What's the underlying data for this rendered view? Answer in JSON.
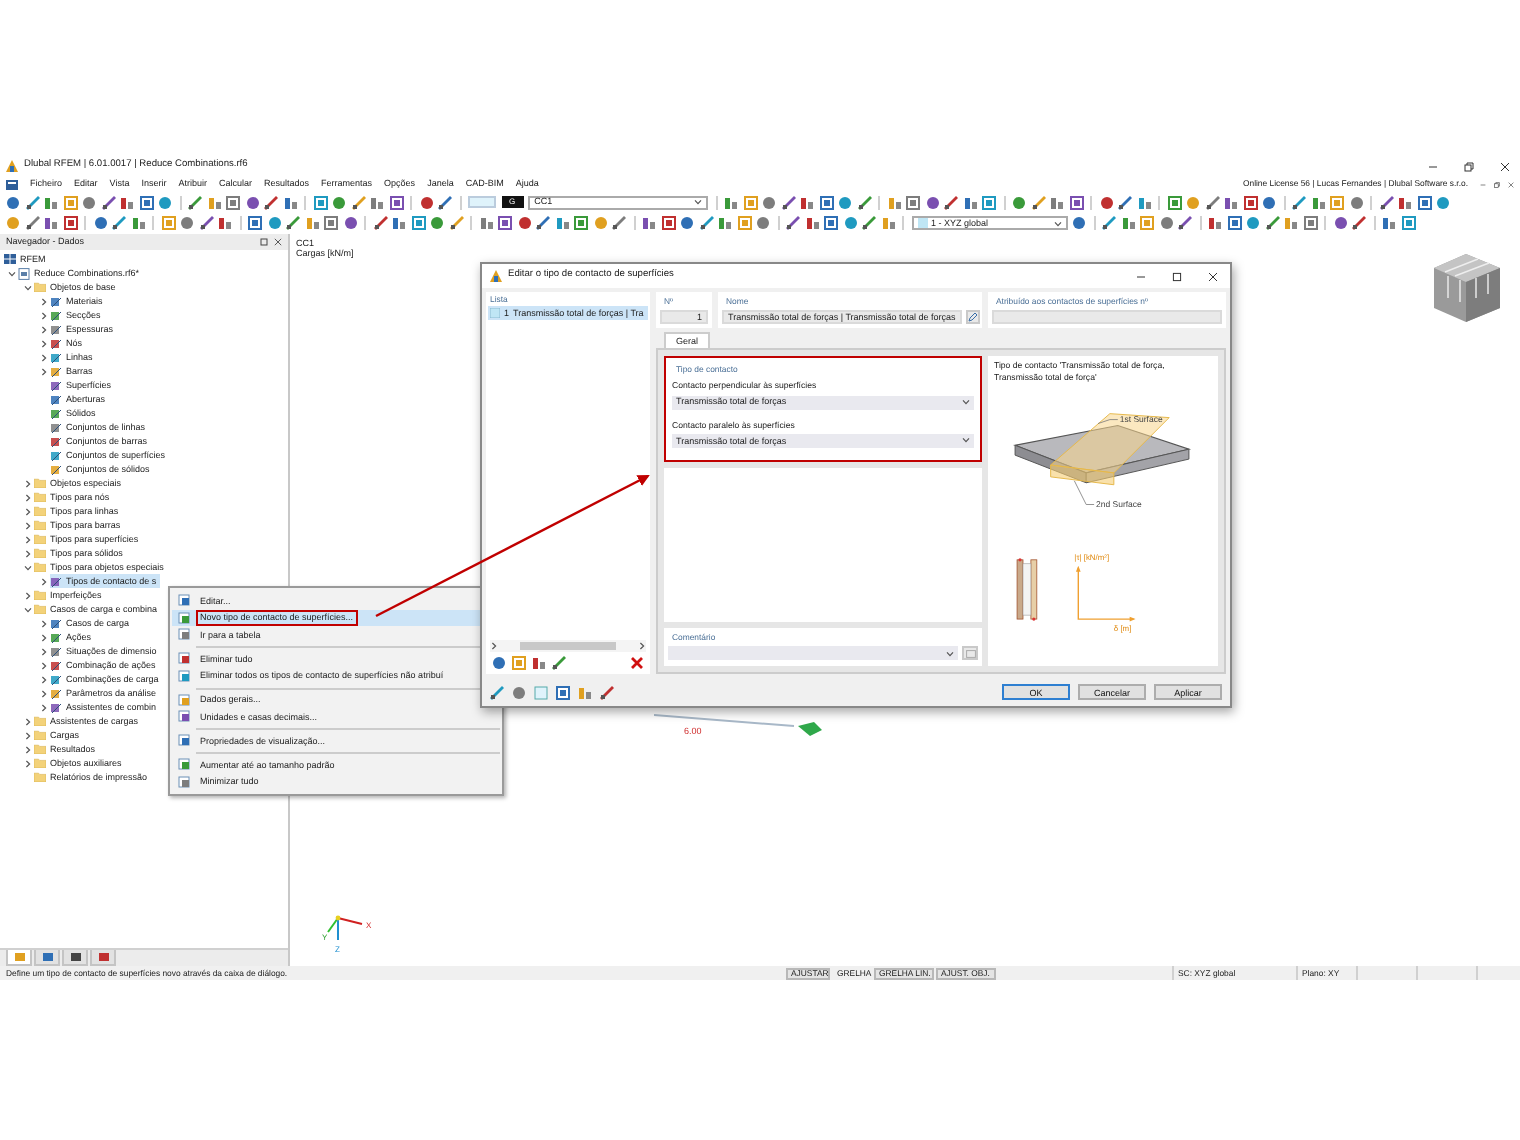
{
  "window": {
    "title": "Dlubal RFEM | 6.01.0017 | Reduce Combinations.rf6"
  },
  "menu_bar": {
    "items": [
      "Ficheiro",
      "Editar",
      "Vista",
      "Inserir",
      "Atribuir",
      "Calcular",
      "Resultados",
      "Ferramentas",
      "Opções",
      "Janela",
      "CAD-BIM",
      "Ajuda"
    ],
    "license": "Online License 56 | Lucas Fernandes | Dlubal Software s.r.o."
  },
  "toolbar": {
    "load_case_tag": "G",
    "load_case": "CC1",
    "coordinate_system": "1 - XYZ global"
  },
  "navigator": {
    "title": "Navegador - Dados",
    "root": "RFEM",
    "tree": [
      {
        "label": "Reduce Combinations.rf6*",
        "kind": "file",
        "expanded": true,
        "selected": false,
        "children": [
          {
            "label": "Objetos de base",
            "kind": "folder",
            "expanded": true,
            "selected": false,
            "children": [
              {
                "label": "Materiais",
                "kind": "item",
                "expanded": false,
                "selected": false
              },
              {
                "label": "Secções",
                "kind": "item",
                "expanded": false,
                "selected": false
              },
              {
                "label": "Espessuras",
                "kind": "item",
                "expanded": false,
                "selected": false
              },
              {
                "label": "Nós",
                "kind": "item",
                "expanded": false,
                "selected": false
              },
              {
                "label": "Linhas",
                "kind": "item",
                "expanded": false,
                "selected": false
              },
              {
                "label": "Barras",
                "kind": "item",
                "expanded": false,
                "selected": false
              },
              {
                "label": "Superfícies",
                "kind": "item",
                "selected": false
              },
              {
                "label": "Aberturas",
                "kind": "item",
                "selected": false
              },
              {
                "label": "Sólidos",
                "kind": "item",
                "selected": false
              },
              {
                "label": "Conjuntos de linhas",
                "kind": "item",
                "selected": false
              },
              {
                "label": "Conjuntos de barras",
                "kind": "item",
                "selected": false
              },
              {
                "label": "Conjuntos de superfícies",
                "kind": "item",
                "selected": false
              },
              {
                "label": "Conjuntos de sólidos",
                "kind": "item",
                "selected": false
              }
            ]
          },
          {
            "label": "Objetos especiais",
            "kind": "folder",
            "expanded": false,
            "selected": false
          },
          {
            "label": "Tipos para nós",
            "kind": "folder",
            "expanded": false,
            "selected": false
          },
          {
            "label": "Tipos para linhas",
            "kind": "folder",
            "expanded": false,
            "selected": false
          },
          {
            "label": "Tipos para barras",
            "kind": "folder",
            "expanded": false,
            "selected": false
          },
          {
            "label": "Tipos para superfícies",
            "kind": "folder",
            "expanded": false,
            "selected": false
          },
          {
            "label": "Tipos para sólidos",
            "kind": "folder",
            "expanded": false,
            "selected": false
          },
          {
            "label": "Tipos para objetos especiais",
            "kind": "folder",
            "expanded": true,
            "selected": false,
            "children": [
              {
                "label": "Tipos de contacto de s",
                "kind": "item",
                "expanded": false,
                "selected": true
              }
            ]
          },
          {
            "label": "Imperfeições",
            "kind": "folder",
            "expanded": false,
            "selected": false
          },
          {
            "label": "Casos de carga e combina",
            "kind": "folder",
            "expanded": true,
            "selected": false,
            "children": [
              {
                "label": "Casos de carga",
                "kind": "item",
                "expanded": false,
                "selected": false
              },
              {
                "label": "Ações",
                "kind": "item",
                "expanded": false,
                "selected": false
              },
              {
                "label": "Situações de dimensio",
                "kind": "item",
                "expanded": false,
                "selected": false
              },
              {
                "label": "Combinação de ações",
                "kind": "item",
                "expanded": false,
                "selected": false
              },
              {
                "label": "Combinações de carga",
                "kind": "item",
                "expanded": false,
                "selected": false
              },
              {
                "label": "Parâmetros da análise",
                "kind": "item",
                "expanded": false,
                "selected": false
              },
              {
                "label": "Assistentes de combin",
                "kind": "item",
                "expanded": false,
                "selected": false
              }
            ]
          },
          {
            "label": "Assistentes de cargas",
            "kind": "folder",
            "expanded": false,
            "selected": false
          },
          {
            "label": "Cargas",
            "kind": "folder",
            "expanded": false,
            "selected": false
          },
          {
            "label": "Resultados",
            "kind": "folder",
            "expanded": false,
            "selected": false
          },
          {
            "label": "Objetos auxiliares",
            "kind": "folder",
            "expanded": false,
            "selected": false
          },
          {
            "label": "Relatórios de impressão",
            "kind": "folder",
            "selected": false
          }
        ]
      }
    ],
    "tabs": [
      {
        "selected": true
      },
      {
        "selected": false
      },
      {
        "selected": false
      },
      {
        "selected": false
      }
    ]
  },
  "viewport": {
    "title": "CC1",
    "subtitle": "Cargas [kN/m]",
    "dimension": "6.00",
    "axes": [
      "X",
      "Y",
      "Z"
    ]
  },
  "context_menu": {
    "items": [
      {
        "kind": "item",
        "label": "Editar...",
        "selected": false,
        "highlighted": false
      },
      {
        "kind": "item",
        "label": "Novo tipo de contacto de superfícies...",
        "selected": true,
        "highlighted": true
      },
      {
        "kind": "item",
        "label": "Ir para a tabela",
        "selected": false,
        "highlighted": false
      },
      {
        "kind": "separator"
      },
      {
        "kind": "item",
        "label": "Eliminar tudo",
        "selected": false,
        "highlighted": false
      },
      {
        "kind": "item",
        "label": "Eliminar todos os tipos de contacto de superfícies não atribuí",
        "selected": false,
        "highlighted": false
      },
      {
        "kind": "separator"
      },
      {
        "kind": "item",
        "label": "Dados gerais...",
        "selected": false,
        "highlighted": false
      },
      {
        "kind": "item",
        "label": "Unidades e casas decimais...",
        "selected": false,
        "highlighted": false
      },
      {
        "kind": "separator"
      },
      {
        "kind": "item",
        "label": "Propriedades de visualização...",
        "selected": false,
        "highlighted": false
      },
      {
        "kind": "separator"
      },
      {
        "kind": "item",
        "label": "Aumentar até ao tamanho padrão",
        "selected": false,
        "highlighted": false
      },
      {
        "kind": "item",
        "label": "Minimizar tudo",
        "selected": false,
        "highlighted": false
      }
    ]
  },
  "dialog": {
    "title": "Editar o tipo de contacto de superfícies",
    "list": {
      "title": "Lista",
      "items": [
        {
          "number": "1",
          "label": "Transmissão total de forças | Tra",
          "selected": true
        }
      ]
    },
    "number": {
      "label": "Nº",
      "value": "1"
    },
    "name": {
      "label": "Nome",
      "value": "Transmissão total de forças | Transmissão total de forças"
    },
    "assigned": {
      "label": "Atribuído aos contactos de superfícies nº"
    },
    "tabs": [
      {
        "label": "Geral",
        "selected": true
      }
    ],
    "contact_type": {
      "title": "Tipo de contacto",
      "highlighted": true,
      "fields": [
        {
          "label": "Contacto perpendicular às superfícies",
          "value": "Transmissão total de forças"
        },
        {
          "label": "Contacto paralelo às superfícies",
          "value": "Transmissão total de forças"
        }
      ]
    },
    "preview": {
      "caption": "Tipo de contacto 'Transmissão total de força, Transmissão total de força'",
      "first_surface": "1st Surface",
      "second_surface": "2nd Surface",
      "y_axis": "|τ| [kN/m²]",
      "x_axis": "δ [m]"
    },
    "comment": {
      "label": "Comentário"
    },
    "buttons": [
      {
        "label": "OK",
        "default": true
      },
      {
        "label": "Cancelar",
        "default": false
      },
      {
        "label": "Aplicar",
        "default": false
      }
    ]
  },
  "status_bar": {
    "message": "Define um tipo de contacto de superfícies novo através da caixa de diálogo.",
    "toggles": [
      {
        "label": "AJUSTAR",
        "on": true
      },
      {
        "label": "GRELHA",
        "on": false
      },
      {
        "label": "GRELHA LIN.",
        "on": true
      },
      {
        "label": "AJUST. OBJ.",
        "on": true
      }
    ],
    "coordinate_system": "SC: XYZ global",
    "plane": "Plano: XY"
  }
}
